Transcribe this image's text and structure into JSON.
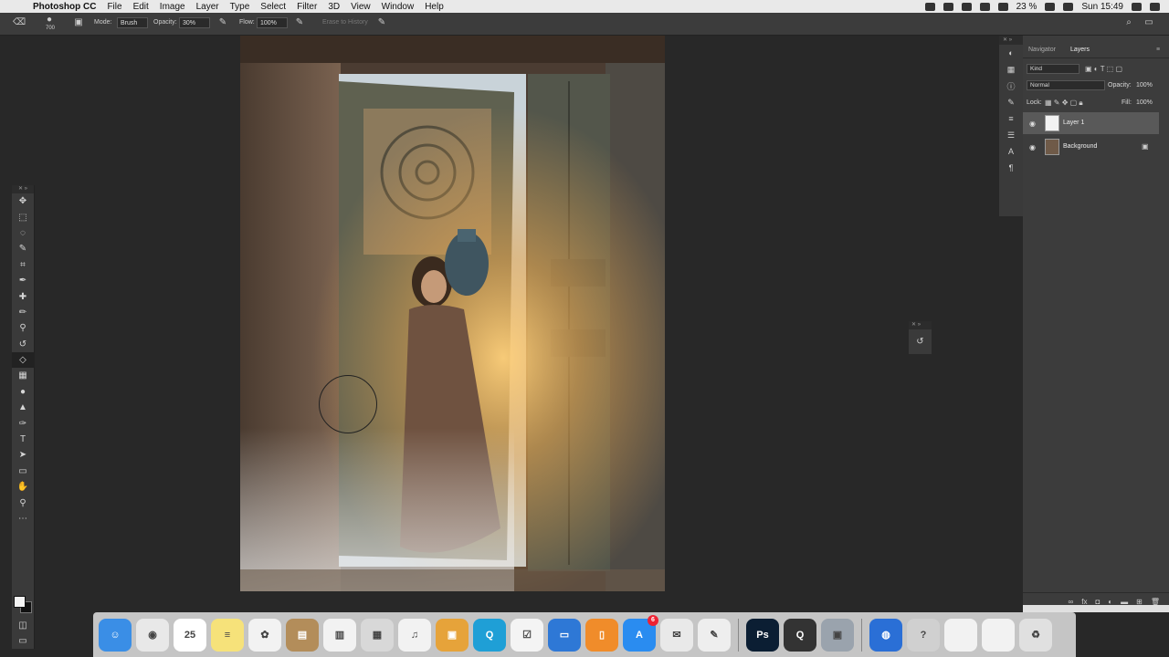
{
  "menubar": {
    "app_name": "Photoshop CC",
    "items": [
      "File",
      "Edit",
      "Image",
      "Layer",
      "Type",
      "Select",
      "Filter",
      "3D",
      "View",
      "Window",
      "Help"
    ],
    "battery": "23 %",
    "clock": "Sun 15:49"
  },
  "options": {
    "brush_size": "700",
    "mode_label": "Mode:",
    "mode_value": "Brush",
    "opacity_label": "Opacity:",
    "opacity_value": "30%",
    "flow_label": "Flow:",
    "flow_value": "100%",
    "erase_history": "Erase to History"
  },
  "toolbar": {
    "tools": [
      "move-tool",
      "marquee-tool",
      "lasso-tool",
      "quick-select-tool",
      "crop-tool",
      "eyedropper-tool",
      "spot-healing-tool",
      "brush-tool",
      "clone-stamp-tool",
      "history-brush-tool",
      "eraser-tool",
      "gradient-tool",
      "blur-tool",
      "dodge-tool",
      "pen-tool",
      "type-tool",
      "path-select-tool",
      "shape-tool",
      "hand-tool",
      "zoom-tool",
      "more-tools"
    ],
    "active_tool": "eraser-tool",
    "glyphs": [
      "✥",
      "⬚",
      "◌",
      "✎",
      "⌗",
      "✒",
      "✚",
      "✏",
      "⚲",
      "↺",
      "◇",
      "▦",
      "●",
      "▲",
      "✑",
      "T",
      "➤",
      "▭",
      "✋",
      "⚲",
      "⋯"
    ]
  },
  "layers_panel": {
    "tabs": [
      "Navigator",
      "Layers"
    ],
    "active_tab": "Layers",
    "filter_kind": "Kind",
    "blend_mode": "Normal",
    "opacity_label": "Opacity:",
    "opacity_value": "100%",
    "lock_label": "Lock:",
    "fill_label": "Fill:",
    "fill_value": "100%",
    "layers": [
      {
        "name": "Layer 1",
        "visible": true,
        "active": true,
        "locked": false
      },
      {
        "name": "Background",
        "visible": true,
        "active": false,
        "locked": true
      }
    ],
    "footer_icons": [
      "link-icon",
      "fx-icon",
      "mask-icon",
      "adjustment-icon",
      "group-icon",
      "new-layer-icon",
      "trash-icon"
    ]
  },
  "dock": {
    "apps": [
      {
        "name": "Finder",
        "color": "#3a8ee6",
        "label": "☺"
      },
      {
        "name": "Chrome",
        "color": "#e8e8e8",
        "label": "◉"
      },
      {
        "name": "Calendar",
        "color": "#ffffff",
        "label": "25"
      },
      {
        "name": "Notes",
        "color": "#f6e27a",
        "label": "≡"
      },
      {
        "name": "Photos",
        "color": "#f2f2f2",
        "label": "✿"
      },
      {
        "name": "Contacts",
        "color": "#b38d5a",
        "label": "▤"
      },
      {
        "name": "Numbers",
        "color": "#f2f2f2",
        "label": "▥"
      },
      {
        "name": "Preview",
        "color": "#d8d8d8",
        "label": "▦"
      },
      {
        "name": "iTunes",
        "color": "#f2f2f2",
        "label": "♫"
      },
      {
        "name": "Folder",
        "color": "#e6a33a",
        "label": "▣"
      },
      {
        "name": "QuickTime",
        "color": "#1f9fd6",
        "label": "Q"
      },
      {
        "name": "Reminders",
        "color": "#f4f4f4",
        "label": "☑"
      },
      {
        "name": "Keynote",
        "color": "#2e78d6",
        "label": "▭"
      },
      {
        "name": "iBooks",
        "color": "#f08c2a",
        "label": "▯"
      },
      {
        "name": "App Store",
        "color": "#2a8cf0",
        "label": "A",
        "badge": "6"
      },
      {
        "name": "Mail",
        "color": "#e9e9e9",
        "label": "✉"
      },
      {
        "name": "TextEdit",
        "color": "#eeeeee",
        "label": "✎"
      },
      {
        "name": "Photoshop",
        "color": "#0b1e33",
        "label": "Ps"
      },
      {
        "name": "QuickTime Player",
        "color": "#333333",
        "label": "Q"
      },
      {
        "name": "Image Capture",
        "color": "#9aa3ad",
        "label": "▣"
      },
      {
        "name": "Network",
        "color": "#2a6fd6",
        "label": "◍"
      },
      {
        "name": "Help",
        "color": "#d0d0d0",
        "label": "?"
      },
      {
        "name": "Window 1",
        "color": "#f2f2f2",
        "label": ""
      },
      {
        "name": "Window 2",
        "color": "#f2f2f2",
        "label": ""
      },
      {
        "name": "Trash",
        "color": "#e0e0e0",
        "label": "♻"
      }
    ]
  }
}
